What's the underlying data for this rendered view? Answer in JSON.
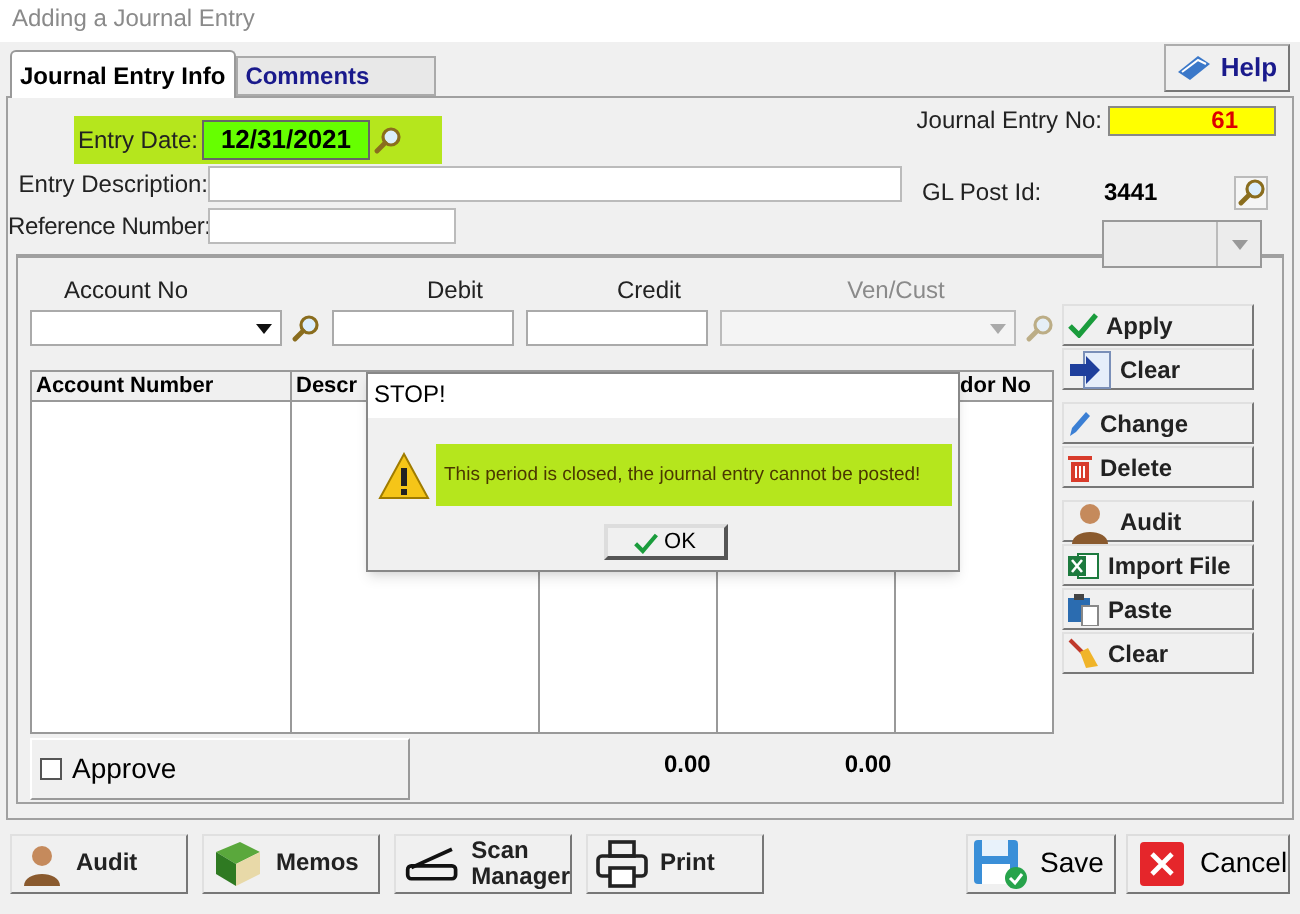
{
  "window": {
    "title": "Adding a Journal Entry"
  },
  "tabs": [
    {
      "label": "Journal Entry Info",
      "selected": true
    },
    {
      "label": "Comments",
      "selected": false
    }
  ],
  "help_button": "Help",
  "header": {
    "entry_date": {
      "label": "Entry Date:",
      "value": "12/31/2021"
    },
    "entry_description": {
      "label": "Entry Description:"
    },
    "reference_number": {
      "label": "Reference Number:"
    },
    "journal_entry_no": {
      "label": "Journal Entry No:",
      "value": "61"
    },
    "gl_post_id": {
      "label": "GL Post Id:",
      "value": "3441"
    }
  },
  "line_entry": [
    {
      "label": "Account No",
      "kind": "combo",
      "disabled": false
    },
    {
      "label": "Debit",
      "kind": "text",
      "disabled": false
    },
    {
      "label": "Credit",
      "kind": "text",
      "disabled": false
    },
    {
      "label": "Ven/Cust",
      "kind": "combo",
      "disabled": true
    }
  ],
  "line_buttons": [
    {
      "label": "Apply"
    },
    {
      "label": "Clear"
    },
    {
      "label": "Change"
    },
    {
      "label": "Delete"
    },
    {
      "label": "Audit"
    },
    {
      "label": "Import File"
    },
    {
      "label": "Paste"
    },
    {
      "label": "Clear"
    }
  ],
  "grid": {
    "columns": [
      "Account Number",
      "Descr",
      "dor No"
    ],
    "totals": [
      "0.00",
      "0.00"
    ]
  },
  "approve": {
    "label": "Approve",
    "checked": false
  },
  "bottom_buttons": [
    {
      "label": "Audit"
    },
    {
      "label": "Memos"
    },
    {
      "label": "Scan Manager"
    },
    {
      "label": "Print"
    }
  ],
  "save_button": "Save",
  "cancel_button": "Cancel",
  "dialog": {
    "title": "STOP!",
    "message": "This period is closed, the journal entry cannot be posted!",
    "button": "OK"
  }
}
